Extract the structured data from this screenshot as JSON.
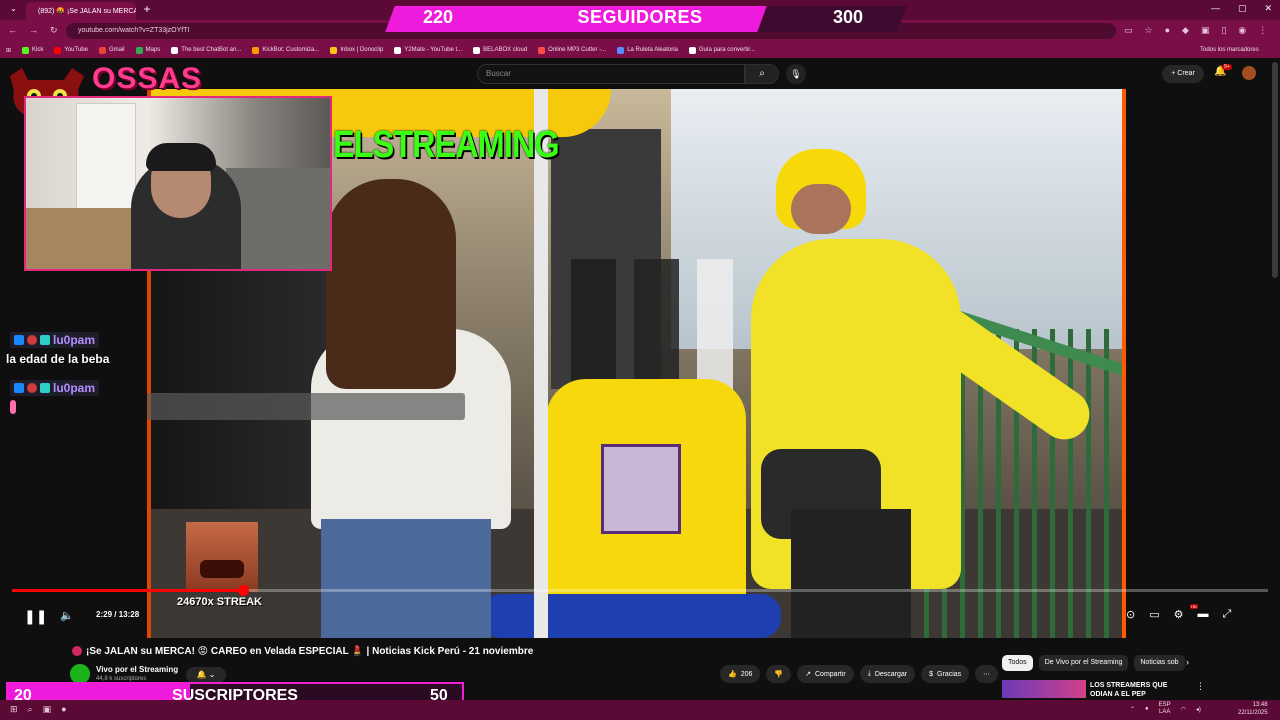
{
  "browser": {
    "tab_title": "(892) 🤬 ¡Se JALAN su MERCA!",
    "url": "youtube.com/watch?v=ZT33jzOYfTI",
    "bookmarks": [
      {
        "label": "Kick",
        "color": "#53fc18"
      },
      {
        "label": "YouTube",
        "color": "#ff0000"
      },
      {
        "label": "Gmail",
        "color": "#ea4335"
      },
      {
        "label": "Maps",
        "color": "#34a853"
      },
      {
        "label": "The best ChatBot an...",
        "color": "#ffffff"
      },
      {
        "label": "KickBot: Customiza...",
        "color": "#ff9900"
      },
      {
        "label": "Inbox | Donoclip",
        "color": "#f5c518"
      },
      {
        "label": "Y2Mate - YouTube t...",
        "color": "#ffffff"
      },
      {
        "label": "BELABOX cloud",
        "color": "#ffffff"
      },
      {
        "label": "Online MP3 Cutter -...",
        "color": "#ff4a4a"
      },
      {
        "label": "La Ruleta Aleatoria",
        "color": "#5b8cff"
      },
      {
        "label": "Guía para convertir...",
        "color": "#ffffff"
      }
    ],
    "all_bookmarks": "Todos los marcadores"
  },
  "youtube": {
    "search_placeholder": "Buscar",
    "create_label": "Crear",
    "notifications_badge": "9+",
    "video_title": "¡Se JALAN su MERCA! 😡 CAREO en Velada ESPECIAL 💄 | Noticias Kick Perú - 21 noviembre",
    "channel_name": "Vivo por el Streaming",
    "channel_subs": "44,8 k suscriptores",
    "likes": "206",
    "share_label": "Compartir",
    "download_label": "Descargar",
    "thanks_label": "Gracias",
    "time_current": "2:29",
    "time_total": "13:28",
    "progress_fraction": 0.184,
    "chips": [
      {
        "label": "Todos",
        "active": true
      },
      {
        "label": "De Vivo por el Streaming",
        "active": false
      },
      {
        "label": "Noticias sob",
        "active": false
      }
    ],
    "reco_title": "LOS STREAMERS QUE ODIAN A EL PEP"
  },
  "overlay": {
    "brand": "OSSAS",
    "video_watermark": "ELSTREAMING",
    "followers_label": "SEGUIDORES",
    "followers_current": "220",
    "followers_goal": "300",
    "subs_label": "SUSCRIPTORES",
    "subs_current": "20",
    "subs_goal": "50",
    "streak_text": "24670x STREAK",
    "chat": [
      {
        "user": "lu0pam",
        "message": "la edad de la beba"
      },
      {
        "user": "lu0pam",
        "message": ""
      }
    ]
  },
  "taskbar": {
    "lang": "ESP",
    "lang2": "LAA",
    "time": "13:48",
    "date": "22/11/2025"
  },
  "colors": {
    "accent_magenta": "#ef1bdc",
    "brand_pink": "#ff3c8e",
    "watermark_green": "#39ff14",
    "chrome": "#7a0f48"
  }
}
